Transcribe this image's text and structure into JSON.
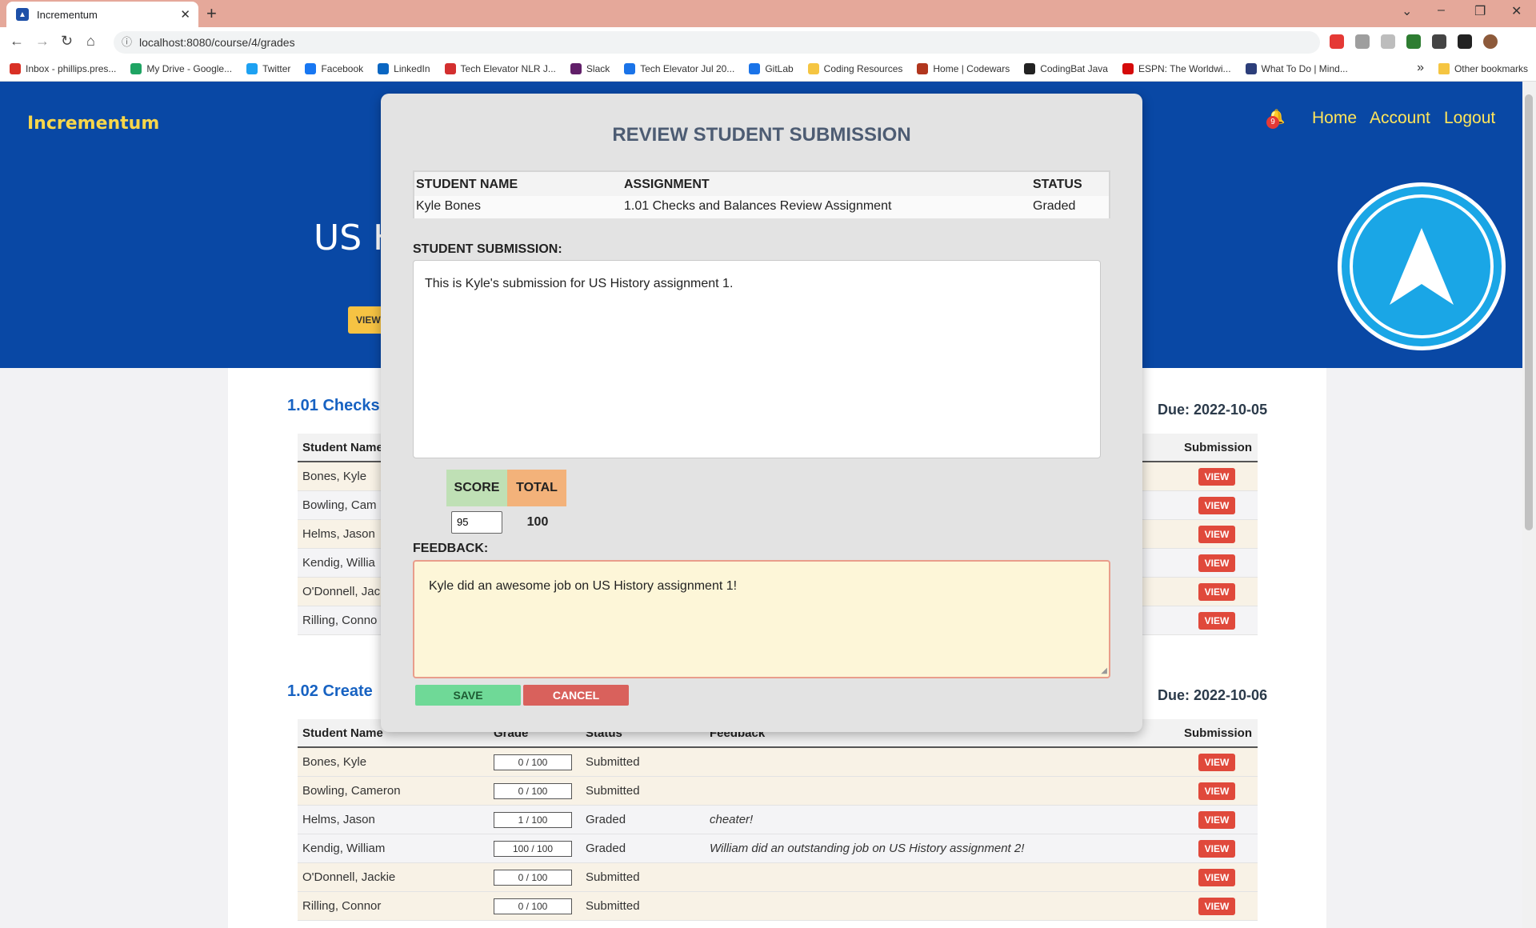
{
  "browser": {
    "tab_title": "Incrementum",
    "url": "localhost:8080/course/4/grades",
    "bookmarks": [
      {
        "label": "Inbox - phillips.pres...",
        "color": "#d93025"
      },
      {
        "label": "My Drive - Google...",
        "color": "#1fa463"
      },
      {
        "label": "Twitter",
        "color": "#1da1f2"
      },
      {
        "label": "Facebook",
        "color": "#1877f2"
      },
      {
        "label": "LinkedIn",
        "color": "#0a66c2"
      },
      {
        "label": "Tech Elevator NLR J...",
        "color": "#d32f2f"
      },
      {
        "label": "Slack",
        "color": "#611f69"
      },
      {
        "label": "Tech Elevator Jul 20...",
        "color": "#1a73e8"
      },
      {
        "label": "GitLab",
        "color": "#1a73e8"
      },
      {
        "label": "Coding Resources",
        "color": "#f5c542"
      },
      {
        "label": "Home | Codewars",
        "color": "#b1361e"
      },
      {
        "label": "CodingBat Java",
        "color": "#222222"
      },
      {
        "label": "ESPN: The Worldwi...",
        "color": "#d50a0a"
      },
      {
        "label": "What To Do | Mind...",
        "color": "#2c3e7a"
      }
    ],
    "other_bookmarks": "Other bookmarks",
    "overflow": "»"
  },
  "header": {
    "logo": "Incrementum",
    "notification_count": "9",
    "nav": [
      "Home",
      "Account",
      "Logout"
    ],
    "course_title": "US H",
    "hero_button": "VIEW"
  },
  "assignments": [
    {
      "title": "1.01 Checks",
      "due": "Due: 2022-10-05",
      "columns": [
        "Student Name",
        "Submission"
      ],
      "rows": [
        {
          "name": "Bones, Kyle",
          "action": "VIEW"
        },
        {
          "name": "Bowling, Cam",
          "action": "VIEW"
        },
        {
          "name": "Helms, Jason",
          "action": "VIEW"
        },
        {
          "name": "Kendig, Willia",
          "action": "VIEW"
        },
        {
          "name": "O'Donnell, Jac",
          "action": "VIEW"
        },
        {
          "name": "Rilling, Conno",
          "action": "VIEW"
        }
      ]
    },
    {
      "title": "1.02 Create",
      "due": "Due: 2022-10-06",
      "columns": [
        "Student Name",
        "Grade",
        "Status",
        "Feedback",
        "Submission"
      ],
      "rows": [
        {
          "name": "Bones, Kyle",
          "grade": "0 / 100",
          "status": "Submitted",
          "feedback": "",
          "action": "VIEW"
        },
        {
          "name": "Bowling, Cameron",
          "grade": "0 / 100",
          "status": "Submitted",
          "feedback": "",
          "action": "VIEW"
        },
        {
          "name": "Helms, Jason",
          "grade": "1 / 100",
          "status": "Graded",
          "feedback": "cheater!",
          "action": "VIEW"
        },
        {
          "name": "Kendig, William",
          "grade": "100 / 100",
          "status": "Graded",
          "feedback": "William did an outstanding job on US History assignment 2!",
          "action": "VIEW"
        },
        {
          "name": "O'Donnell, Jackie",
          "grade": "0 / 100",
          "status": "Submitted",
          "feedback": "",
          "action": "VIEW"
        },
        {
          "name": "Rilling, Connor",
          "grade": "0 / 100",
          "status": "Submitted",
          "feedback": "",
          "action": "VIEW"
        }
      ]
    }
  ],
  "modal": {
    "title": "REVIEW STUDENT SUBMISSION",
    "headers": {
      "student": "STUDENT NAME",
      "assignment": "ASSIGNMENT",
      "status": "STATUS"
    },
    "values": {
      "student": "Kyle Bones",
      "assignment": "1.01 Checks and Balances Review Assignment",
      "status": "Graded"
    },
    "submission_label": "STUDENT SUBMISSION:",
    "submission_text": "This is Kyle's submission for US History assignment 1.",
    "score_label": "SCORE",
    "total_label": "TOTAL",
    "score_value": "95",
    "total_value": "100",
    "feedback_label": "FEEDBACK:",
    "feedback_text": "Kyle did an awesome job on US History assignment 1!",
    "save": "SAVE",
    "cancel": "CANCEL"
  },
  "colors": {
    "hero": "#0948a5",
    "accent": "#ffe55a",
    "view_button": "#e0493b",
    "save": "#6fd997",
    "cancel": "#d9615c",
    "score_header": "#bfe0b5",
    "total_header": "#f3b27a"
  }
}
